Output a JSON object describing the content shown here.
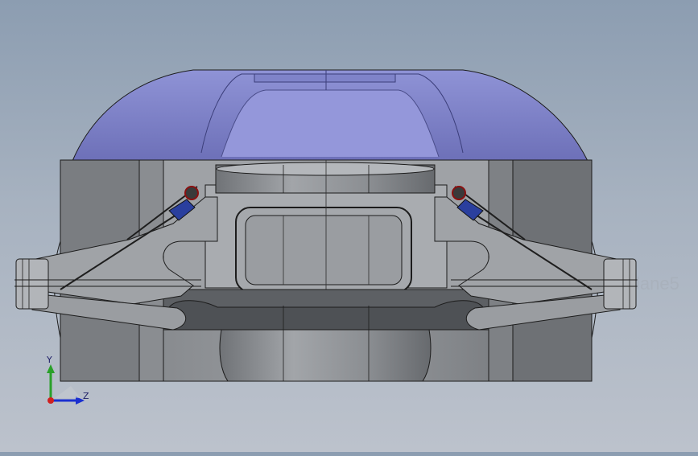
{
  "viewport": {
    "plane_label": "lane5",
    "triad": {
      "y_label": "Y",
      "z_label": "Z",
      "y_color": "#2aa02a",
      "z_color": "#1a2fd0",
      "x_color": "#d02020"
    }
  },
  "colors": {
    "background_top": "#8c9db1",
    "background_bottom": "#bcc2cc",
    "dome": "#7c80c8",
    "block": "#8e9195",
    "block_dark": "#6f7276",
    "arm": "#9c9fa3",
    "bracket": "#2a3f9e",
    "edge": "#1c1c1c"
  }
}
